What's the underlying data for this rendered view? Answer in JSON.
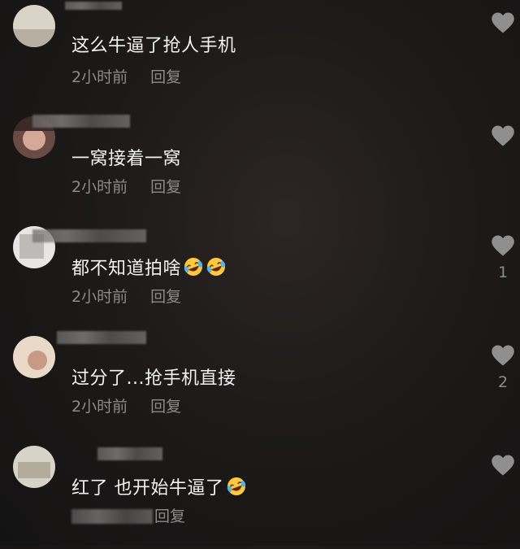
{
  "comments": [
    {
      "text": "这么牛逼了抢人手机",
      "time": "2小时前",
      "reply": "回复",
      "likes": "",
      "emoji_count": 0
    },
    {
      "text": "一窝接着一窝",
      "time": "2小时前",
      "reply": "回复",
      "likes": "",
      "emoji_count": 0
    },
    {
      "text": "都不知道拍啥",
      "time": "2小时前",
      "reply": "回复",
      "likes": "1",
      "emoji_count": 2
    },
    {
      "text": "过分了...抢手机直接",
      "time": "2小时前",
      "reply": "回复",
      "likes": "2",
      "emoji_count": 0
    },
    {
      "text": "红了 也开始牛逼了",
      "time": "",
      "reply": "回复",
      "likes": "",
      "emoji_count": 1
    }
  ],
  "colors": {
    "background": "#1b1918",
    "text": "#f2f2f2",
    "meta": "#8b8b8b",
    "heart": "#8f8f8f"
  },
  "icons": {
    "like": "heart-icon",
    "emoji": "rolling-on-floor-laughing-emoji"
  }
}
